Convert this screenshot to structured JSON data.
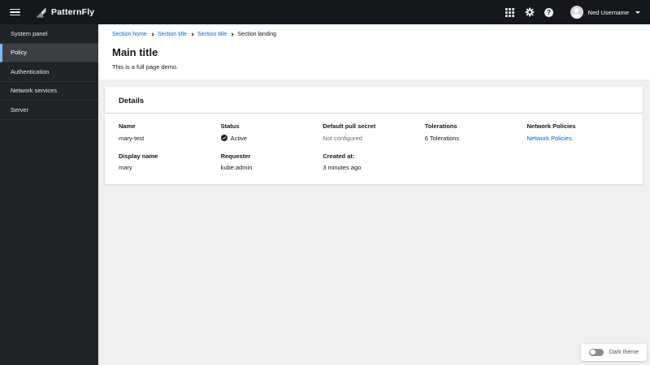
{
  "masthead": {
    "brand": "PatternFly",
    "user": {
      "name": "Ned Username"
    },
    "help_icon_glyph": "?"
  },
  "sidebar": {
    "active_index": 1,
    "items": [
      {
        "label": "System panel"
      },
      {
        "label": "Policy"
      },
      {
        "label": "Authentication"
      },
      {
        "label": "Network services"
      },
      {
        "label": "Server"
      }
    ]
  },
  "breadcrumb": {
    "items": [
      {
        "label": "Section home",
        "link": true
      },
      {
        "label": "Section title",
        "link": true
      },
      {
        "label": "Section title",
        "link": true
      },
      {
        "label": "Section landing",
        "link": false
      }
    ]
  },
  "page": {
    "title": "Main title",
    "subtitle": "This is a full page demo."
  },
  "details_card": {
    "title": "Details",
    "fields": [
      {
        "label": "Name",
        "value": "mary-test",
        "type": "text"
      },
      {
        "label": "Status",
        "value": "Active",
        "type": "status"
      },
      {
        "label": "Default pull secret",
        "value": "Not configured",
        "type": "muted"
      },
      {
        "label": "Tolerations",
        "value": "6 Tolerations",
        "type": "text"
      },
      {
        "label": "Network Policies",
        "value": "Network Policies",
        "type": "link"
      },
      {
        "label": "Display name",
        "value": "mary",
        "type": "text"
      },
      {
        "label": "Requester",
        "value": "kube:admin",
        "type": "text"
      },
      {
        "label": "Created at:",
        "value": "3 minutes ago",
        "type": "text"
      }
    ]
  },
  "theme_toggle": {
    "label": "Dark theme",
    "state": "off"
  },
  "icons": {
    "menu": "hamburger-bars",
    "app_launcher": "3x3-grid",
    "settings": "gear",
    "help": "question-circle",
    "status_active": "check-circle-filled-dark",
    "breadcrumb_separator": "chevron-right",
    "user_caret": "caret-down"
  },
  "colors": {
    "masthead_bg": "#15171a",
    "sidebar_bg": "#212427",
    "sidebar_active_bg": "#3c3f42",
    "active_border": "#73bcf7",
    "link": "#0066cc",
    "page_bg": "#f0f0f0",
    "muted_text": "#6a6e73",
    "text": "#151515"
  }
}
